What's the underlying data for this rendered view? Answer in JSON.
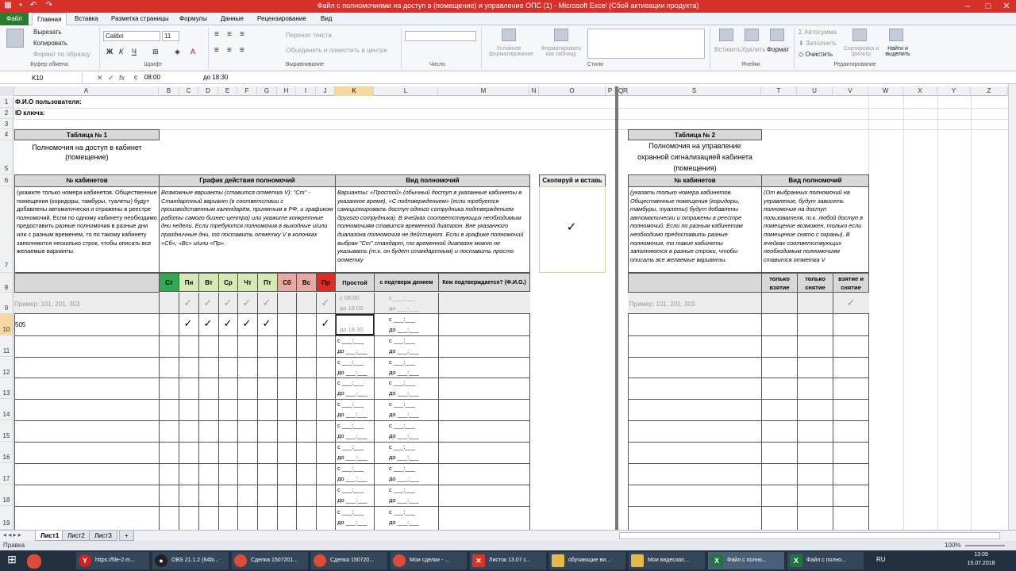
{
  "window": {
    "title": "Файл с полномочиями на доступ в (помещение) и управление ОПС (1)  -  Microsoft Excel (Сбой активации продукта)"
  },
  "ribbon_tabs": [
    "Файл",
    "Главная",
    "Вставка",
    "Разметка страницы",
    "Формулы",
    "Данные",
    "Рецензирование",
    "Вид"
  ],
  "ribbon": {
    "cut": "Вырезать",
    "copy": "Копировать",
    "format_painter": "Формат по образцу",
    "clipboard_group": "Буфер обмена",
    "font_name": "Calibri",
    "font_size": "11",
    "font_group": "Шрифт",
    "wrap_text": "Перенос текста",
    "merge_center": "Объединить и поместить в центре",
    "alignment_group": "Выравнивание",
    "number_group": "Число",
    "cond_format": "Условное форматирование",
    "format_table": "Форматировать как таблицу",
    "styles_group": "Стили",
    "insert": "Вставить",
    "delete": "Удалить",
    "format": "Формат",
    "cells_group": "Ячейки",
    "autosum": "Автосумма",
    "fill": "Заполнить",
    "clear": "Очистить",
    "sort_filter": "Сортировка и фильтр",
    "find_select": "Найти и выделить",
    "editing_group": "Редактирование"
  },
  "formula_bar": {
    "name_box": "K10",
    "formula_c": "с",
    "formula_time1": "08:00",
    "formula_time2": "до 18:30"
  },
  "columns": [
    "A",
    "B",
    "C",
    "D",
    "E",
    "F",
    "G",
    "H",
    "I",
    "J",
    "K",
    "L",
    "M",
    "N",
    "O",
    "P",
    "Q",
    "R",
    "S",
    "T",
    "U",
    "V",
    "W",
    "X",
    "Y",
    "Z"
  ],
  "rows": [
    "1",
    "2",
    "3",
    "4",
    "5",
    "6",
    "7",
    "8",
    "9",
    "10",
    "11",
    "12",
    "13",
    "14",
    "15",
    "16",
    "17",
    "18",
    "19"
  ],
  "sheet": {
    "user_fio": "Ф.И.О пользователя:",
    "key_id": "ID ключа:",
    "table1_title": "Таблица № 1",
    "table1_subtitle": "Полномочия на доступ в кабинет (помещение)",
    "col_cabinets": "№ кабинетов",
    "col_schedule": "График действия полномочий",
    "col_kind": "Вид полномочий",
    "col_copy": "Скопируй и вставь",
    "desc_cabinets": "(укажите только номера кабинетов. Общественные помещения (коридоры, тамбуры, туалеты) будут добавлены автоматически и отражены в реестре полномочий. Если по одному кабинету необходимо предоставить разные полномочия в разные дни или с разным временем, то по такому кабинету заполняются несколько строк, чтобы описать все желаемые варианты.",
    "desc_schedule": "Возможные варианты (ставится отметка V):  \"Ст\" - Стандартный вариант (в соответствии с производственным календарём, принятым в РФ, и графиком работы самого бизнес-центра) или укажите конкретные дни недели. Если требуются полномочия в выходные и/или праздничные дни, то поставить отметку V в колонках «Сб», «Вс» и/или  «Пр».",
    "desc_kind": "Варианты: «Простой» (обычный доступ в указанные кабинеты в указанное время), «С подтверждением» (если требуется санкционировать доступ одного сотрудника подтверждением другого сотрудника). В ячейках соответствующих необходимым полномочиям ставится временной диапазон. Вне указанного диапазона полномочия не действуют. Если в графике полномочий выбран \"Ст\" стандарт, то временной диапазон можно не указывать (т.к. он будет стандартным) и поставить просто отметку",
    "days": [
      "Ст",
      "Пн",
      "Вт",
      "Ср",
      "Чт",
      "Пт",
      "Сб",
      "Вс",
      "Пр"
    ],
    "col_simple": "Простой",
    "col_confirm": "с подтверж дением",
    "col_who": "Кем подтверждается? (Ф.И.О.)",
    "example": "Пример: 101, 201, 303",
    "ex_from": "с   08:00",
    "ex_to": "до 18:05",
    "blank_from": "с  ___:___",
    "blank_to": "до ___:___",
    "row10_cab": "505",
    "row10_to": "до 18:30",
    "table2_title": "Таблица № 2",
    "table2_subtitle": "Полномочия на управление охранной сигнализацией кабинета (помещения)",
    "t2_col_cabinets": "№ кабинетов",
    "t2_col_kind": "Вид полномочий",
    "t2_desc_cabinets": "(указать только номера кабинетов. Общественные помещения (коридоры, тамбуры, туалеты) будут добавлены автоматически и отражены в реестре полномочий. Если по разным кабинетам необходимо предоставить разные полномочия, то такие кабинеты заполняются в разные строки, чтобы описать все желаемые варианты.",
    "t2_desc_kind": "(От выбранных полномочий на управление, будут зависеть полномочия на доступ пользователя, т.к. любой доступ в помещение возможен, только если помещение снято с охраны). В ячейках соответствующих необходимым полномочиям ставится отметка V",
    "t2_only_arm": "только взятие",
    "t2_only_disarm": "только снятие",
    "t2_both": "взятие и снятие",
    "t2_example": "Пример: 101, 201, 303"
  },
  "sheet_tabs": [
    "Лист1",
    "Лист2",
    "Лист3"
  ],
  "status": "Правка",
  "zoom": "100%",
  "taskbar": [
    "https://file-2.m...",
    "OBS 21.1.2 (64bi...",
    "Сделка 1507201...",
    "Сделка 150720...",
    "Мои сделки - ...",
    "Листок 13.07 с...",
    "обучающие ви...",
    "Мои видеозап...",
    "Файл с полно...",
    "Файл с полно..."
  ],
  "tray": {
    "lang": "RU",
    "time": "13:09",
    "date": "15.07.2018"
  }
}
